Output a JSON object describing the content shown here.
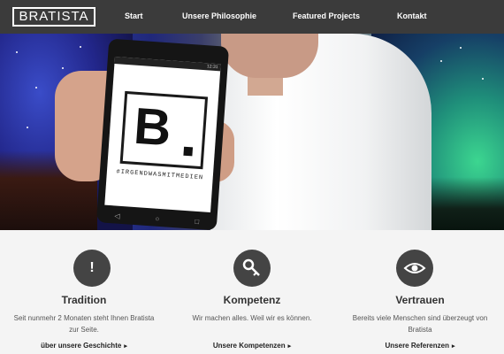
{
  "nav": {
    "logo": "BRATISTA",
    "links": [
      "Start",
      "Unsere Philosophie",
      "Featured Projects",
      "Kontakt"
    ]
  },
  "hero": {
    "phone": {
      "time": "12:31",
      "brand_letter": "B",
      "tagline": "#IRGENDWASMITMEDIEN"
    }
  },
  "features": [
    {
      "icon": "exclamation-icon",
      "title": "Tradition",
      "text": "Seit nunmehr 2 Monaten steht Ihnen Bratista zur Seite.",
      "link": "über unsere Geschichte"
    },
    {
      "icon": "key-icon",
      "title": "Kompetenz",
      "text": "Wir machen alles. Weil wir es können.",
      "link": "Unsere Kompetenzen"
    },
    {
      "icon": "eye-icon",
      "title": "Vertrauen",
      "text": "Bereits viele Menschen sind überzeugt von Bratista",
      "link": "Unsere Referenzen"
    }
  ],
  "colors": {
    "nav_bg": "#3b3b3b",
    "icon_bg": "#444444",
    "page_bg": "#f4f4f4"
  }
}
